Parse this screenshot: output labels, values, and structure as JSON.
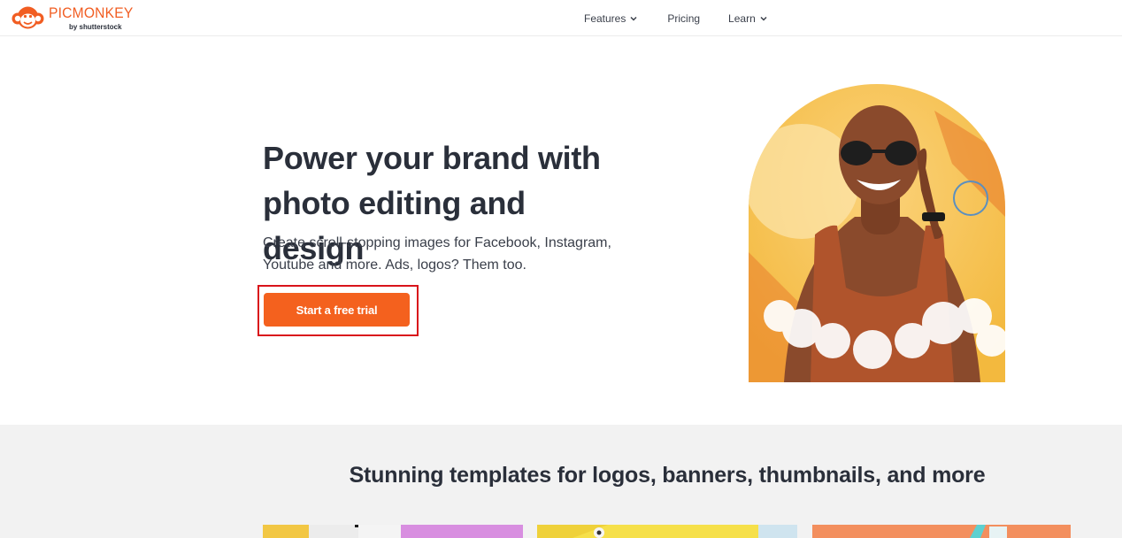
{
  "header": {
    "logo": {
      "word": "PICMONKEY",
      "by": "by shutterstock"
    },
    "nav": [
      {
        "label": "Features",
        "has_menu": true
      },
      {
        "label": "Pricing",
        "has_menu": false
      },
      {
        "label": "Learn",
        "has_menu": true
      }
    ]
  },
  "hero": {
    "title": "Power your brand with photo editing and design",
    "subtitle": "Create scroll-stopping images for Facebook, Instagram, Youtube and more. Ads, logos? Them too.",
    "cta_label": "Start a free trial"
  },
  "templates": {
    "title": "Stunning templates for logos, banners, thumbnails, and more"
  },
  "colors": {
    "brand_orange": "#f4611e",
    "logo_orange": "#f15d22",
    "highlight_outline": "#d9141b",
    "section_bg": "#f2f2f2"
  }
}
